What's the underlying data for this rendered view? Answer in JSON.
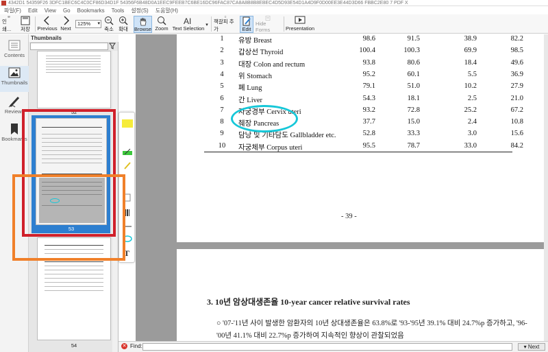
{
  "window": {
    "title": "4342D1 54359F26 3DFC1BEC6C4C0CF86D34D1F 54356F6B48D0A1EEC9FEEB7C6BE16DC96FAC87CA8A8B8B8EBEC4D5D93E54D1A4D9F0D00EE3E44D3D66 FBBC2E80 7 PDF X"
  },
  "menu": [
    "파일(F)",
    "Edit",
    "View",
    "Go",
    "Bookmarks",
    "Tools",
    "설정(S)",
    "도움말(H)"
  ],
  "toolbar": {
    "print": "인쇄...",
    "save": "저장",
    "previous": "Previous",
    "next": "Next",
    "zoom_value": "125%",
    "zoom_out": "축소",
    "zoom_in": "확대",
    "browse": "Browse",
    "zoom": "Zoom",
    "text_selection": "Text Selection",
    "add_bookmark": "책갈피 추가",
    "edit": "Edit",
    "hide_forms": "Hide Forms",
    "presentation": "Presentation"
  },
  "rail": {
    "contents": "Contents",
    "thumbnails": "Thumbnails",
    "reviews": "Reviews",
    "bookmarks": "Bookmarks"
  },
  "thumbpanel": {
    "title": "Thumbnails",
    "pages": [
      "52",
      "53",
      "54"
    ]
  },
  "table": {
    "rows": [
      {
        "n": "1",
        "site": "유방 Breast",
        "v1": "98.6",
        "v2": "91.5",
        "v3": "38.9",
        "v4": "82.2"
      },
      {
        "n": "2",
        "site": "갑상선 Thyroid",
        "v1": "100.4",
        "v2": "100.3",
        "v3": "69.9",
        "v4": "98.5"
      },
      {
        "n": "3",
        "site": "대장 Colon and rectum",
        "v1": "93.8",
        "v2": "80.6",
        "v3": "18.4",
        "v4": "49.6"
      },
      {
        "n": "4",
        "site": "위 Stomach",
        "v1": "95.2",
        "v2": "60.1",
        "v3": "5.5",
        "v4": "36.9"
      },
      {
        "n": "5",
        "site": "폐 Lung",
        "v1": "79.1",
        "v2": "51.0",
        "v3": "10.2",
        "v4": "27.9"
      },
      {
        "n": "6",
        "site": "간 Liver",
        "v1": "54.3",
        "v2": "18.1",
        "v3": "2.5",
        "v4": "21.0"
      },
      {
        "n": "7",
        "site": "자궁경부 Cervix uteri",
        "v1": "93.2",
        "v2": "72.8",
        "v3": "25.2",
        "v4": "67.2"
      },
      {
        "n": "8",
        "site": "췌장 Pancreas",
        "v1": "37.7",
        "v2": "15.0",
        "v3": "2.4",
        "v4": "10.8"
      },
      {
        "n": "9",
        "site": "담낭 및 기타담도 Gallbladder etc.",
        "v1": "52.8",
        "v2": "33.3",
        "v3": "3.0",
        "v4": "15.6"
      },
      {
        "n": "10",
        "site": "자궁체부 Corpus uteri",
        "v1": "95.5",
        "v2": "78.7",
        "v3": "33.0",
        "v4": "84.2"
      }
    ]
  },
  "page_number": "- 39 -",
  "section_title": "3. 10년 암상대생존율 10-year cancer relative survival rates",
  "paragraph": "○ '07-'11년 사이 발생한 암환자의 10년 상대생존율은 63.8%로 '93-'95년 39.1% 대비 24.7%p 증가하고, '96-'00년 41.1% 대비 22.7%p 증가하여 지속적인 향상이 관찰되었음",
  "findbar": {
    "label": "Find:",
    "value": "",
    "next": "Next"
  },
  "colors": {
    "red_annotation": "#d0202a",
    "orange_annotation": "#f0802a",
    "cyan_annotation": "#16c7d8",
    "selection_blue": "#2d7fd0"
  }
}
